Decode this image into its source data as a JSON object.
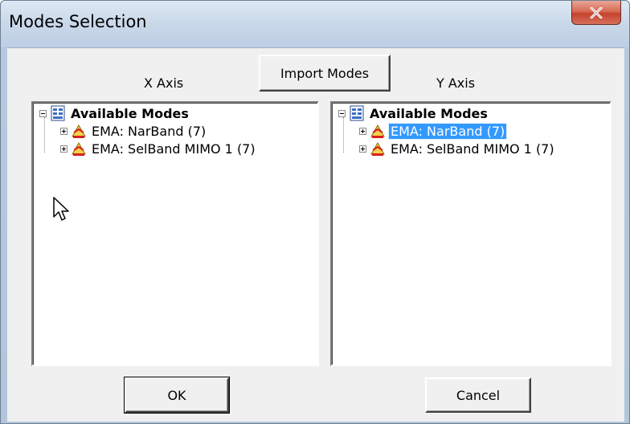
{
  "window": {
    "title": "Modes Selection"
  },
  "buttons": {
    "import": "Import Modes",
    "ok": "OK",
    "cancel": "Cancel"
  },
  "axes": {
    "x_label": "X Axis",
    "y_label": "Y Axis"
  },
  "x_tree": {
    "root": "Available Modes",
    "items": [
      {
        "label": "EMA: NarBand (7)",
        "selected": false
      },
      {
        "label": "EMA: SelBand MIMO 1 (7)",
        "selected": false
      }
    ]
  },
  "y_tree": {
    "root": "Available Modes",
    "items": [
      {
        "label": "EMA: NarBand (7)",
        "selected": true
      },
      {
        "label": "EMA: SelBand MIMO 1 (7)",
        "selected": false
      }
    ]
  },
  "icons": {
    "close": "close-icon",
    "tree_root": "modes-list-icon",
    "tree_item": "mode-shape-icon",
    "cursor": "mouse-pointer-icon"
  },
  "colors": {
    "selection": "#3399ff",
    "close_button": "#c6432d"
  }
}
